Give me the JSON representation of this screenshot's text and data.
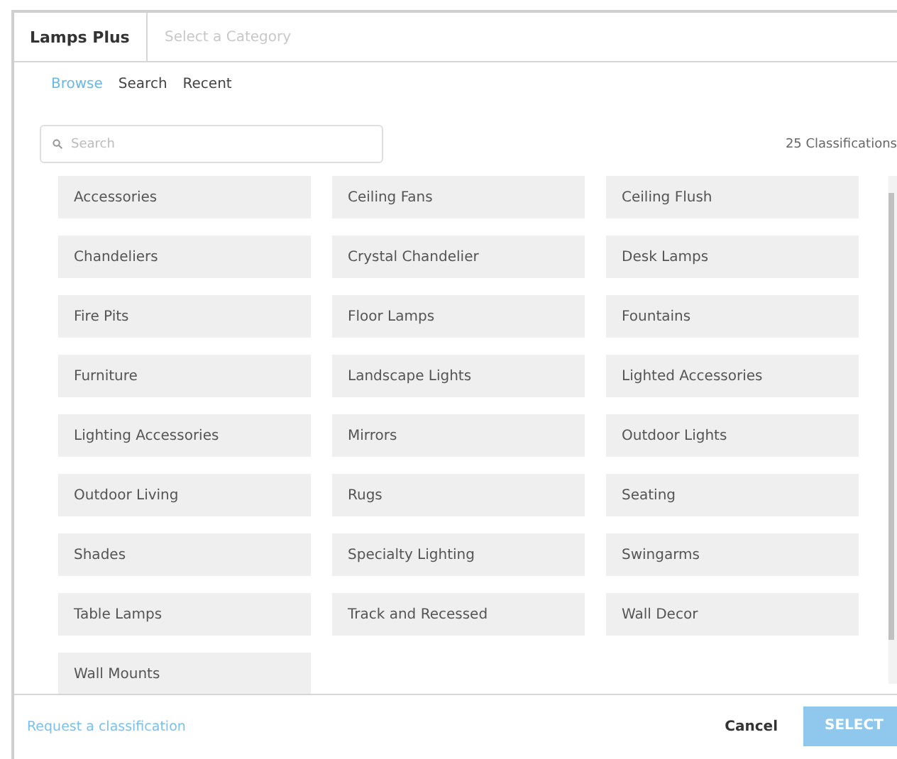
{
  "header": {
    "title": "Lamps Plus",
    "category_placeholder": "Select a Category"
  },
  "tabs": [
    {
      "label": "Browse",
      "selected": true
    },
    {
      "label": "Search",
      "selected": false
    },
    {
      "label": "Recent",
      "selected": false
    }
  ],
  "search": {
    "placeholder": "Search"
  },
  "count": "25 Classifications",
  "categories": [
    "Accessories",
    "Ceiling Fans",
    "Ceiling Flush",
    "Chandeliers",
    "Crystal Chandelier",
    "Desk Lamps",
    "Fire Pits",
    "Floor Lamps",
    "Fountains",
    "Furniture",
    "Landscape Lights",
    "Lighted Accessories",
    "Lighting Accessories",
    "Mirrors",
    "Outdoor Lights",
    "Outdoor Living",
    "Rugs",
    "Seating",
    "Shades",
    "Specialty Lighting",
    "Swingarms",
    "Table Lamps",
    "Track and Recessed",
    "Wall Decor",
    "Wall Mounts"
  ],
  "footer": {
    "link": "Request a classification",
    "cancel": "Cancel",
    "select": {
      "label": "SELECT",
      "disabled": true
    }
  }
}
